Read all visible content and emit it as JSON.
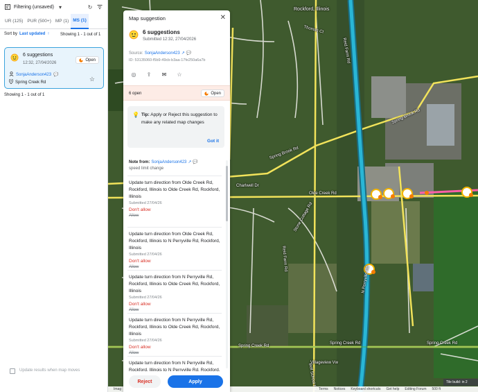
{
  "left_panel": {
    "filter_title": "Filtering (unsaved)",
    "tabs": [
      {
        "label": "UR (125)",
        "active": false
      },
      {
        "label": "PUR (500+)",
        "active": false
      },
      {
        "label": "MP (1)",
        "active": false
      },
      {
        "label": "MS (1)",
        "active": true
      }
    ],
    "sort_label": "Sort by",
    "sort_value": "Last updated",
    "showing_top": "Showing 1 - 1 out of 1",
    "card": {
      "title": "6 suggestions",
      "date": "12:32, 27/04/2026",
      "open_label": "Open",
      "user": "SonjaAnderson423",
      "road": "Spring Creek Rd"
    },
    "showing_bottom": "Showing 1 - 1 out of 1",
    "footer_checkbox": "Update results when map moves"
  },
  "panel": {
    "title": "Map suggestion",
    "count_title": "6 suggestions",
    "submitted": "Submitted 12:32, 27/04/2026",
    "source_label": "Source:",
    "source_user": "SonjaAnderson423",
    "id": "ID: 53135060-f5b9-49cb-b3aa-17fe250a6a7b",
    "open_bar_label": "6 open",
    "open_bar_button": "Open",
    "tip": {
      "prefix": "Tip:",
      "text": "Apply or Reject this suggestion to make any related map changes",
      "got_it": "Got it"
    },
    "note_label": "Note from:",
    "note_user": "SonjaAnderson423",
    "note_text": "speed limit change",
    "items": [
      {
        "desc": "Update turn direction from Olde Creek Rd, Rockford, Illinois to Olde Creek Rd, Rockford, Illinois",
        "sub": "Submitted 27/04/26",
        "dont": "Don't allow",
        "allow": "Allow"
      },
      {
        "desc": "Update turn direction from Olde Creek Rd, Rockford, Illinois to N Perryville Rd, Rockford, Illinois",
        "sub": "Submitted 27/04/26",
        "dont": "Don't allow",
        "allow": "Allow"
      },
      {
        "desc": "Update turn direction from N Perryville Rd, Rockford, Illinois to Olde Creek Rd, Rockford, Illinois",
        "sub": "Submitted 27/04/26",
        "dont": "Don't allow",
        "allow": "Allow"
      },
      {
        "desc": "Update turn direction from N Perryville Rd, Rockford, Illinois to Olde Creek Rd, Rockford, Illinois",
        "sub": "Submitted 27/04/26",
        "dont": "Don't allow",
        "allow": "Allow"
      },
      {
        "desc": "Update turn direction from N Perryville Rd, Rockford, Illinois to N Perryville Rd, Rockford, Illinois",
        "sub": "",
        "dont": "",
        "allow": ""
      }
    ],
    "reject_label": "Reject",
    "apply_label": "Apply"
  },
  "map": {
    "labels": {
      "rockford": "Rockford, Illinois",
      "thomas_ct": "Thomas Ct",
      "reid_farm_top": "Reid Farm Rd",
      "spring_brook_right": "Spring Brook Rd",
      "spring_brook_left": "Spring Brook Rd",
      "olde_creek": "Olde Creek Rd",
      "charlwell": "Charlwell Dr",
      "stone_cottage": "Stone Cottage Rd",
      "reid_farm_mid": "Reid Farm Rd",
      "spring_creek_left": "Spring Creek Rd",
      "spring_creek_mid": "Spring Creek Rd",
      "spring_creek_right": "Spring Creek Rd",
      "perryville": "N Perryville Rd",
      "villageview": "Villageview Vw",
      "bell_school": "Bell School Rd"
    },
    "bottom_bar": [
      "Imag",
      "Terms",
      "Notices",
      "Keyboard shortcuts",
      "Get help",
      "Editing Forum",
      "500 ft"
    ],
    "tile_note": "Tile build: in 2"
  },
  "colors": {
    "accent": "#1a73e8",
    "card_border": "#3aa3dd",
    "highway": "#29b6d6",
    "arterial": "#f2e35b",
    "danger": "#d93025",
    "highlight_road": "#ff5fa8"
  }
}
